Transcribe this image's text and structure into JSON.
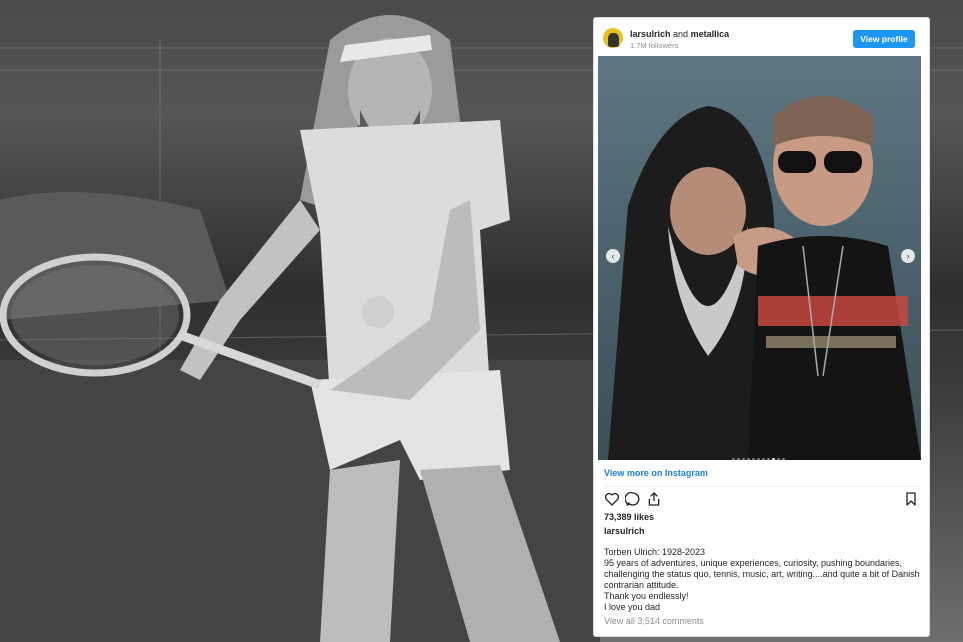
{
  "embed": {
    "account": "larsulrich",
    "joiner": " and ",
    "collaborator": "metallica",
    "followers": "1.7M followers",
    "view_profile_label": "View profile",
    "view_more_label": "View more on Instagram",
    "likes": "73,389 likes",
    "caption_user": "larsulrich",
    "caption_lines": [
      "Torben Ulrich: 1928-2023",
      "95 years of adventures, unique experiences, curiosity, pushing boundaries, challenging the status quo, tennis, music, art, writing....and quite a bit of Danish contrarian attitude.",
      "Thank you endlessly!",
      "I love you dad"
    ],
    "comments_link": "View all 3,514 comments",
    "carousel": {
      "count": 10,
      "active_index": 8
    },
    "colors": {
      "button": "#1c96f0",
      "link": "#1c7fd0"
    },
    "icons": [
      "heart-icon",
      "comment-icon",
      "share-icon",
      "bookmark-icon",
      "chevron-left-icon",
      "chevron-right-icon"
    ]
  }
}
